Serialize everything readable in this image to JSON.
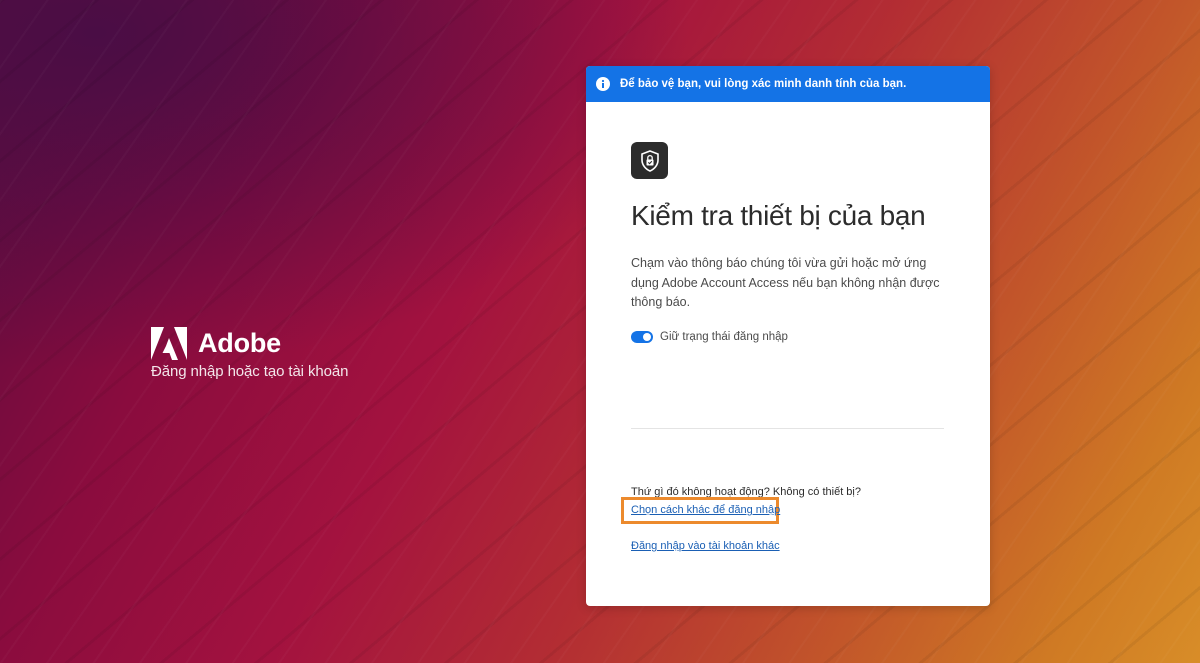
{
  "brand": {
    "name": "Adobe",
    "tagline": "Đăng nhập hoặc tạo tài khoản",
    "logo_icon": "adobe-logo-icon"
  },
  "banner": {
    "icon": "info-icon",
    "text": "Để bảo vệ bạn, vui lòng xác minh danh tính của bạn.",
    "color": "#1473e6"
  },
  "dialog": {
    "icon": "shield-lock-icon",
    "title": "Kiểm tra thiết bị của bạn",
    "description": "Chạm vào thông báo chúng tôi vừa gửi hoặc mở ứng dụng Adobe Account Access nếu bạn không nhận được thông báo.",
    "stay_signed_in": {
      "label": "Giữ trạng thái đăng nhập",
      "checked": true
    },
    "trouble_text": "Thứ gì đó không hoạt động? Không có thiết bị?",
    "alt_method_link": "Chọn cách khác để đăng nhập",
    "other_account_link": "Đăng nhập vào tài khoản khác"
  },
  "colors": {
    "accent": "#1473e6",
    "highlight_box": "#ec8a2d",
    "link": "#1a5fb4"
  }
}
